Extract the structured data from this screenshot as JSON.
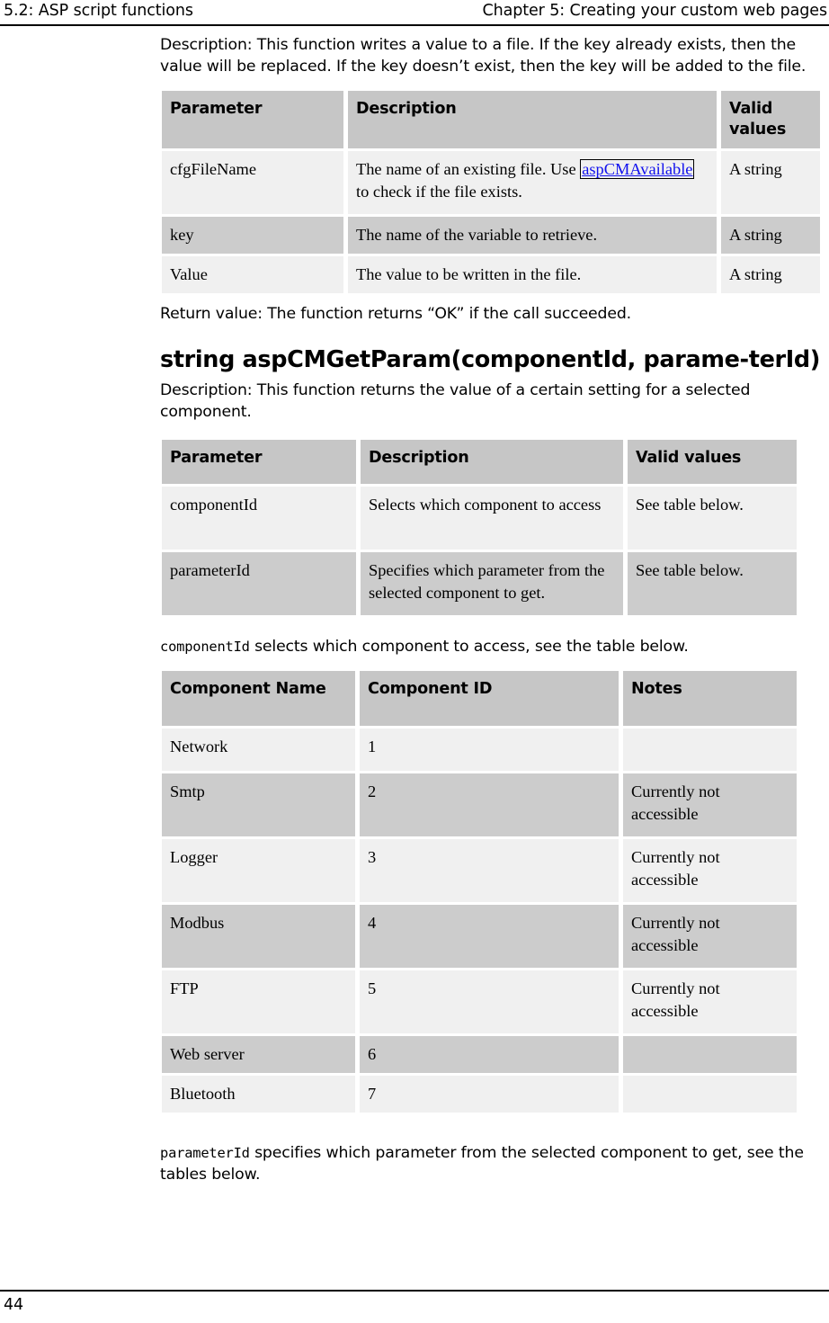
{
  "header": {
    "left": "5.2: ASP script functions",
    "right": "Chapter 5: Creating your custom web pages"
  },
  "footer": {
    "page_number": "44"
  },
  "sections": {
    "write_function": {
      "description": "Description: This function writes a value to a file. If the key already exists, then the value will be replaced. If the key doesn’t exist, then the key will be added to the file.",
      "return_value": "Return value: The function returns “OK” if the call succeeded."
    },
    "get_param": {
      "heading": "string aspCMGetParam(componentId, parame-terId)",
      "description": "Description: This function returns the value of a certain setting for a selected component.",
      "component_intro_code": "componentId",
      "component_intro_text": " selects which component to access, see the table below.",
      "parameter_intro_code": "parameterId",
      "parameter_intro_text": " specifies which parameter from the selected component to get, see the tables below."
    }
  },
  "tables": {
    "write_params": {
      "headers": [
        "Parameter",
        "Description",
        "Valid values"
      ],
      "rows": [
        {
          "parameter": "cfgFileName",
          "description_before": "The name of an existing file. Use ",
          "description_link": "aspCMAvailable",
          "description_after": " to check if the file exists.",
          "valid_values": "A string"
        },
        {
          "parameter": "key",
          "description": "The name of the variable to retrieve.",
          "valid_values": "A string"
        },
        {
          "parameter": "Value",
          "description": "The value to be written in the file.",
          "valid_values": "A string"
        }
      ]
    },
    "getparam_params": {
      "headers": [
        "Parameter",
        "Description",
        "Valid values"
      ],
      "rows": [
        {
          "parameter": "componentId",
          "description": "Selects which component to access",
          "valid_values": "See table below."
        },
        {
          "parameter": "parameterId",
          "description": "Specifies which parameter from the selected component to get.",
          "valid_values": "See table below."
        }
      ]
    },
    "components": {
      "headers": [
        "Component Name",
        "Component ID",
        "Notes"
      ],
      "rows": [
        {
          "name": "Network",
          "id": "1",
          "notes": ""
        },
        {
          "name": "Smtp",
          "id": "2",
          "notes": "Currently not accessible"
        },
        {
          "name": "Logger",
          "id": "3",
          "notes": "Currently not accessible"
        },
        {
          "name": "Modbus",
          "id": "4",
          "notes": "Currently not accessible"
        },
        {
          "name": "FTP",
          "id": "5",
          "notes": "Currently not accessible"
        },
        {
          "name": "Web server",
          "id": "6",
          "notes": ""
        },
        {
          "name": "Bluetooth",
          "id": "7",
          "notes": ""
        }
      ]
    }
  }
}
